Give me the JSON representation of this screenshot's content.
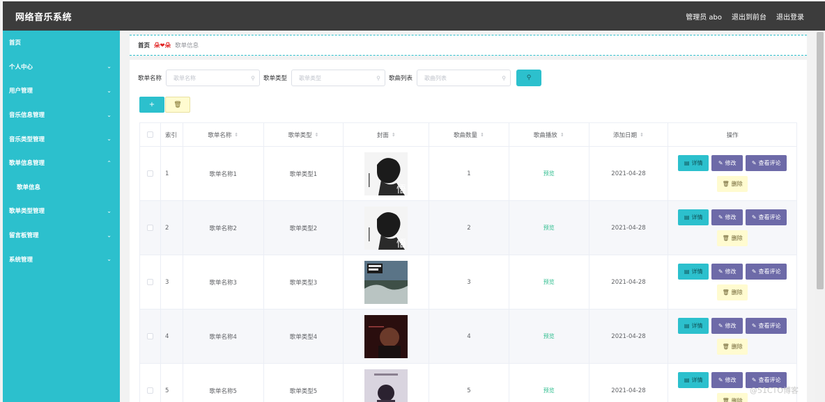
{
  "header": {
    "title": "网络音乐系统",
    "user": "管理员 abo",
    "back_to_front": "退出到前台",
    "logout": "退出登录"
  },
  "sidebar": {
    "items": [
      {
        "label": "首页",
        "chev": ""
      },
      {
        "label": "个人中心",
        "chev": "⌄"
      },
      {
        "label": "用户管理",
        "chev": "⌄"
      },
      {
        "label": "音乐信息管理",
        "chev": "⌄"
      },
      {
        "label": "音乐类型管理",
        "chev": "⌄"
      },
      {
        "label": "歌单信息管理",
        "chev": "⌃"
      },
      {
        "label": "歌单信息",
        "chev": ""
      },
      {
        "label": "歌单类型管理",
        "chev": "⌄"
      },
      {
        "label": "留言板管理",
        "chev": "⌄"
      },
      {
        "label": "系统管理",
        "chev": "⌄"
      }
    ]
  },
  "breadcrumb": {
    "home": "首页",
    "separator": "朵❤朵",
    "current": "歌单信息"
  },
  "search": {
    "name_label": "歌单名称",
    "name_placeholder": "歌单名称",
    "type_label": "歌单类型",
    "type_placeholder": "歌单类型",
    "list_label": "歌曲列表",
    "list_placeholder": "歌曲列表",
    "search_icon": "search-icon"
  },
  "actions": {
    "add": "+",
    "delete_icon": "trash-icon"
  },
  "table": {
    "headers": {
      "index": "索引",
      "name": "歌单名称",
      "type": "歌单类型",
      "cover": "封面",
      "count": "歌曲数量",
      "play": "歌曲播放",
      "date": "添加日期",
      "ops": "操作"
    },
    "rows": [
      {
        "index": "1",
        "name": "歌单名称1",
        "type": "歌单类型1",
        "count": "1",
        "play": "预览",
        "date": "2021-04-28"
      },
      {
        "index": "2",
        "name": "歌单名称2",
        "type": "歌单类型2",
        "count": "2",
        "play": "预览",
        "date": "2021-04-28"
      },
      {
        "index": "3",
        "name": "歌单名称3",
        "type": "歌单类型3",
        "count": "3",
        "play": "预览",
        "date": "2021-04-28"
      },
      {
        "index": "4",
        "name": "歌单名称4",
        "type": "歌单类型4",
        "count": "4",
        "play": "预览",
        "date": "2021-04-28"
      },
      {
        "index": "5",
        "name": "歌单名称5",
        "type": "歌单类型5",
        "count": "5",
        "play": "预览",
        "date": "2021-04-28"
      }
    ],
    "ops": {
      "detail": "详情",
      "edit": "修改",
      "comment": "查看评论",
      "delete": "删除"
    }
  },
  "watermark": "@51CTO博客",
  "colors": {
    "accent": "#2cc0cd",
    "header": "#3c3c3c",
    "purple": "#6d6aa8",
    "yellow": "#fffbd0",
    "preview_green": "#2ebd8e"
  }
}
